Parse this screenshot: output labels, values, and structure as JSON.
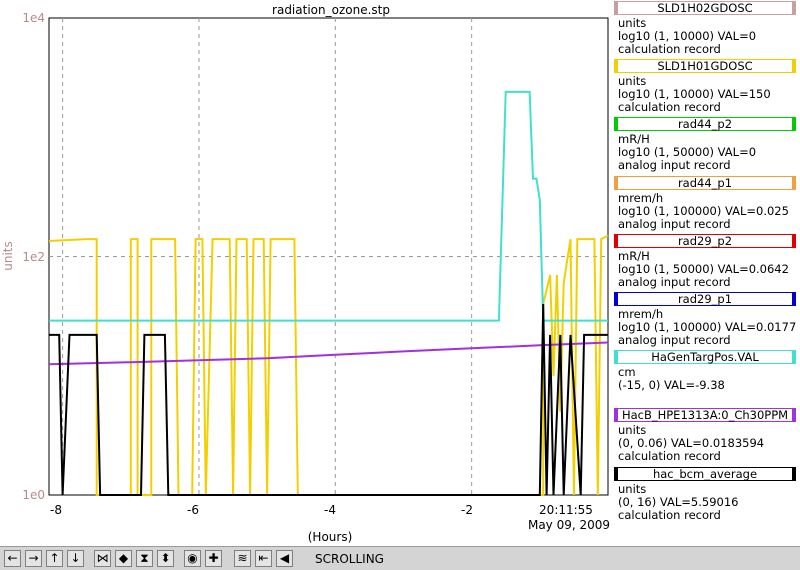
{
  "window": {
    "title": "radiation_ozone.stp"
  },
  "plot": {
    "y_axis_label": "units",
    "y_ticks": [
      "1e4",
      "1e2",
      "1e0"
    ],
    "x_ticks": [
      "-8",
      "-6",
      "-4",
      "-2"
    ],
    "x_axis_label": "(Hours)",
    "time_label": "20:11:55",
    "date_label": "May 09, 2009",
    "colors": {
      "ylabel": "#b98a8a",
      "grid": "#999999"
    }
  },
  "chart_data": {
    "type": "line",
    "title": "radiation_ozone.stp",
    "xlabel": "(Hours)",
    "ylabel": "units",
    "x_range": [
      -8.2,
      0
    ],
    "y_range_log10": [
      0,
      4
    ],
    "y_scale": "log",
    "grid": true,
    "legend_position": "right",
    "series": [
      {
        "name": "SLD1H02GDOSC",
        "color": "#c8a0a0",
        "points": []
      },
      {
        "name": "SLD1H01GDOSC",
        "color": "#f2d000",
        "points": [
          [
            -8.2,
            135
          ],
          [
            -7.65,
            140
          ],
          [
            -7.5,
            140
          ],
          [
            -7.5,
            1
          ],
          [
            -7.0,
            1
          ],
          [
            -7.0,
            140
          ],
          [
            -6.9,
            140
          ],
          [
            -6.9,
            1
          ],
          [
            -6.7,
            1
          ],
          [
            -6.7,
            140
          ],
          [
            -6.35,
            140
          ],
          [
            -6.3,
            1
          ],
          [
            -6.1,
            1
          ],
          [
            -6.05,
            140
          ],
          [
            -5.95,
            140
          ],
          [
            -5.9,
            1
          ],
          [
            -5.8,
            140
          ],
          [
            -5.55,
            140
          ],
          [
            -5.5,
            1
          ],
          [
            -5.45,
            140
          ],
          [
            -5.3,
            140
          ],
          [
            -5.25,
            1
          ],
          [
            -5.2,
            140
          ],
          [
            -5.05,
            140
          ],
          [
            -5.0,
            1
          ],
          [
            -4.95,
            140
          ],
          [
            -4.6,
            140
          ],
          [
            -4.55,
            1
          ],
          [
            -2.1,
            1
          ],
          [
            -1.55,
            1
          ],
          [
            -1.3,
            1
          ],
          [
            -0.95,
            1
          ],
          [
            -0.95,
            40
          ],
          [
            -0.85,
            70
          ],
          [
            -0.8,
            10
          ],
          [
            -0.75,
            70
          ],
          [
            -0.7,
            5
          ],
          [
            -0.65,
            60
          ],
          [
            -0.55,
            140
          ],
          [
            -0.5,
            1
          ],
          [
            -0.45,
            140
          ],
          [
            -0.2,
            140
          ],
          [
            -0.15,
            1
          ],
          [
            -0.1,
            140
          ],
          [
            0,
            150
          ]
        ]
      },
      {
        "name": "rad44_p2",
        "color": "#00cc00",
        "points": []
      },
      {
        "name": "rad44_p1",
        "color": "#f0a040",
        "points": []
      },
      {
        "name": "rad29_p2",
        "color": "#e00000",
        "points": []
      },
      {
        "name": "rad29_p1",
        "color": "#0000d0",
        "points": []
      },
      {
        "name": "HaGenTargPos.VAL",
        "color": "#40e0d0",
        "points": [
          [
            -8.2,
            29
          ],
          [
            -1.6,
            29
          ],
          [
            -1.5,
            2400
          ],
          [
            -1.15,
            2400
          ],
          [
            -1.1,
            450
          ],
          [
            -1.05,
            450
          ],
          [
            -1.0,
            300
          ],
          [
            -0.95,
            29
          ],
          [
            0,
            29
          ]
        ]
      },
      {
        "name": "HacB_HPE1313A:0_Ch30PPM",
        "color": "#a030e0",
        "points": [
          [
            -8.2,
            12.5
          ],
          [
            -7,
            13
          ],
          [
            -6,
            13.5
          ],
          [
            -5,
            14
          ],
          [
            -4,
            15
          ],
          [
            -3,
            16
          ],
          [
            -2,
            17
          ],
          [
            -1,
            18
          ],
          [
            0,
            19
          ]
        ]
      },
      {
        "name": "hac_bcm_average",
        "color": "#000000",
        "points": [
          [
            -8.2,
            22
          ],
          [
            -8.05,
            22
          ],
          [
            -8.0,
            1
          ],
          [
            -7.9,
            22
          ],
          [
            -7.5,
            22
          ],
          [
            -7.45,
            1
          ],
          [
            -6.85,
            1
          ],
          [
            -6.8,
            22
          ],
          [
            -6.5,
            22
          ],
          [
            -6.45,
            1
          ],
          [
            -4.4,
            1
          ],
          [
            -4.35,
            1
          ],
          [
            -1.55,
            1
          ],
          [
            -1.45,
            1
          ],
          [
            -1.2,
            1
          ],
          [
            -1.0,
            1
          ],
          [
            -0.95,
            40
          ],
          [
            -0.9,
            1
          ],
          [
            -0.85,
            22
          ],
          [
            -0.8,
            1
          ],
          [
            -0.7,
            22
          ],
          [
            -0.65,
            1
          ],
          [
            -0.55,
            22
          ],
          [
            -0.4,
            1
          ],
          [
            -0.35,
            22
          ],
          [
            -0.1,
            22
          ],
          [
            0,
            22
          ]
        ]
      }
    ]
  },
  "legend": [
    {
      "name": "SLD1H02GDOSC",
      "unit": "units",
      "range": "log10 (1, 10000)  VAL=0",
      "type": "calculation record",
      "color": "#c8a0a0"
    },
    {
      "name": "SLD1H01GDOSC",
      "unit": "units",
      "range": "log10 (1, 10000) VAL=150",
      "type": "calculation record",
      "color": "#f2d000"
    },
    {
      "name": "rad44_p2",
      "unit": "mR/H",
      "range": "log10 (1, 50000) VAL=0",
      "type": "analog input record",
      "color": "#00cc00"
    },
    {
      "name": "rad44_p1",
      "unit": "mrem/h",
      "range": "log10 (1, 100000) VAL=0.025",
      "type": "analog input record",
      "color": "#f0a040"
    },
    {
      "name": "rad29_p2",
      "unit": "mR/H",
      "range": "log10 (1, 50000) VAL=0.0642",
      "type": "analog input record",
      "color": "#e00000"
    },
    {
      "name": "rad29_p1",
      "unit": "mrem/h",
      "range": "log10 (1, 100000) VAL=0.0177",
      "type": "analog input record",
      "color": "#0000d0"
    },
    {
      "name": "HaGenTargPos.VAL",
      "unit": "cm",
      "range": "(-15, 0) VAL=-9.38",
      "type": "",
      "color": "#40e0d0"
    },
    {
      "name": "HacB_HPE1313A:0_Ch30PPM",
      "unit": "units",
      "range": "(0, 0.06) VAL=0.0183594",
      "type": "calculation record",
      "color": "#a030e0"
    },
    {
      "name": "hac_bcm_average",
      "unit": "units",
      "range": "(0, 16) VAL=5.59016",
      "type": "calculation record",
      "color": "#000000"
    }
  ],
  "toolbar": {
    "status": "SCROLLING",
    "buttons": [
      {
        "icon": "arrow-left-icon",
        "glyph": "←"
      },
      {
        "icon": "arrow-right-icon",
        "glyph": "→"
      },
      {
        "icon": "arrow-up-icon",
        "glyph": "↑"
      },
      {
        "icon": "arrow-down-icon",
        "glyph": "↓"
      },
      {
        "icon": "zoom-x-in-icon",
        "glyph": "⋈"
      },
      {
        "icon": "zoom-x-out-icon",
        "glyph": "◆"
      },
      {
        "icon": "zoom-y-in-icon",
        "glyph": "⧗"
      },
      {
        "icon": "zoom-y-out-icon",
        "glyph": "⬍"
      },
      {
        "icon": "reset-icon",
        "glyph": "◉"
      },
      {
        "icon": "add-icon",
        "glyph": "✚"
      },
      {
        "icon": "autoscale-icon",
        "glyph": "≋"
      },
      {
        "icon": "pan-left-icon",
        "glyph": "⇤"
      },
      {
        "icon": "pan-back-icon",
        "glyph": "◀"
      }
    ]
  }
}
